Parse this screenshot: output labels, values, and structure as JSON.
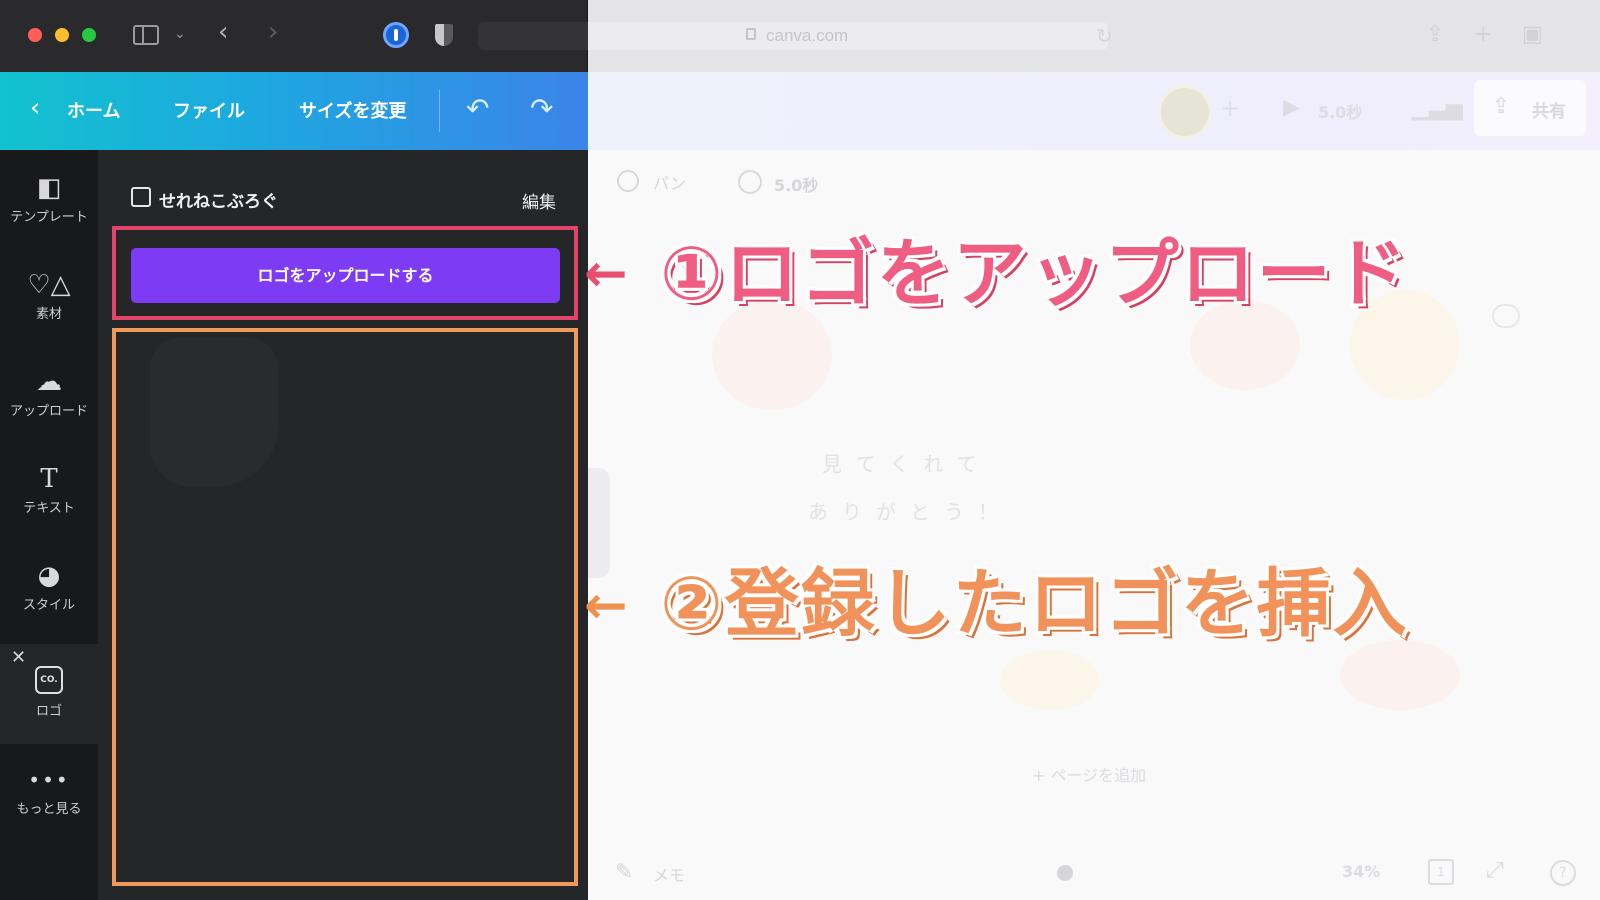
{
  "browser": {
    "url": "canva.com"
  },
  "header": {
    "home_label": "ホーム",
    "file_label": "ファイル",
    "resize_label": "サイズを変更",
    "duration": "5.0秒",
    "share_label": "共有"
  },
  "rail": {
    "items": [
      {
        "label": "テンプレート",
        "icon": "template-icon"
      },
      {
        "label": "素材",
        "icon": "elements-icon"
      },
      {
        "label": "アップロード",
        "icon": "upload-cloud-icon"
      },
      {
        "label": "テキスト",
        "icon": "text-icon"
      },
      {
        "label": "スタイル",
        "icon": "palette-icon"
      },
      {
        "label": "ロゴ",
        "icon": "logo-icon"
      },
      {
        "label": "もっと見る",
        "icon": "more-icon"
      }
    ],
    "logo_badge": "CO."
  },
  "panel": {
    "brand_name": "せれねこぶろぐ",
    "edit_label": "編集",
    "upload_button": "ロゴをアップロードする"
  },
  "editor": {
    "pan_label": "パン",
    "timer_label": "5.0秒",
    "design_line1": "見てくれて",
    "design_line2": "ありがとう！",
    "add_page": "+ ページを追加",
    "memo_label": "メモ",
    "zoom": "34%",
    "page_count": "1"
  },
  "annotations": {
    "step1": "①ロゴをアップロード",
    "step2": "②登録したロゴを挿入",
    "colors": {
      "step1": "#f05d82",
      "step2": "#f0925a",
      "upload_button": "#7d3bf3"
    }
  }
}
